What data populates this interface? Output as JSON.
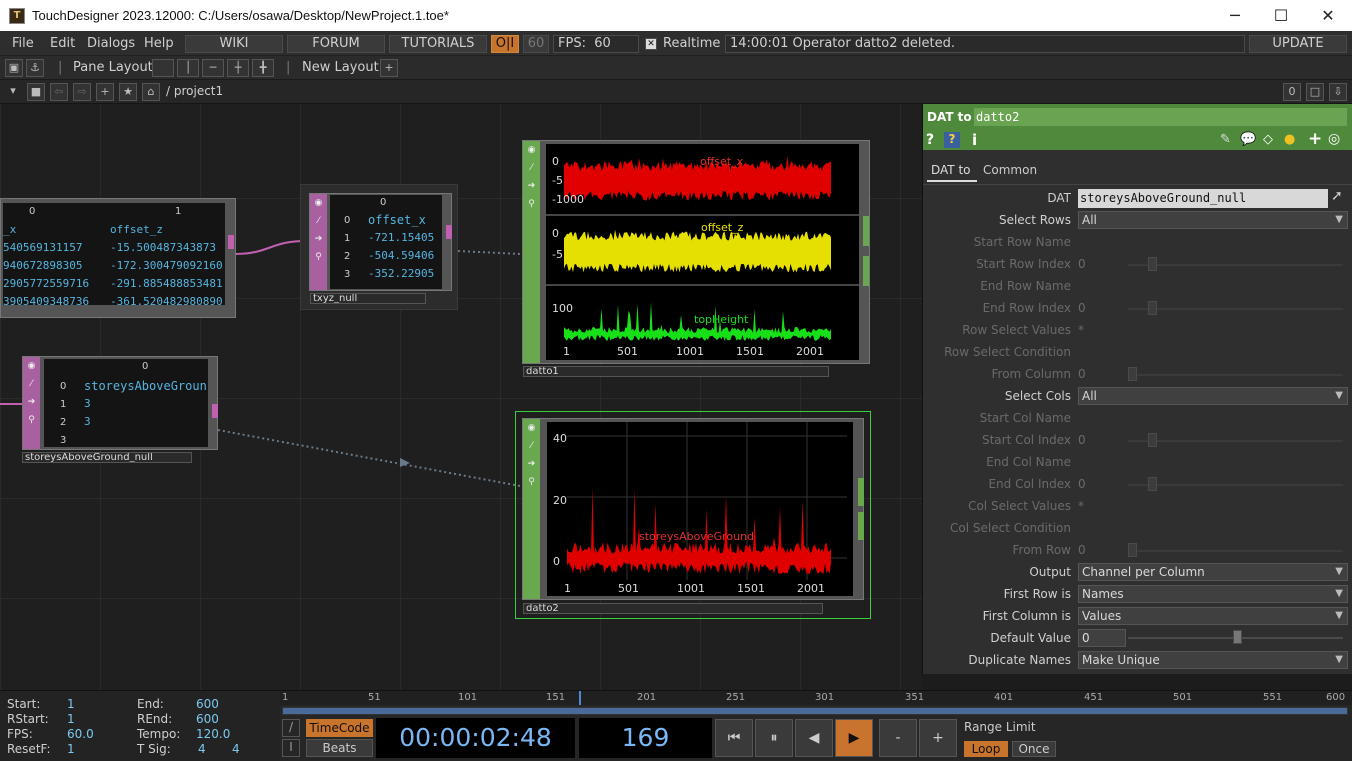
{
  "window": {
    "title": "TouchDesigner 2023.12000: C:/Users/osawa/Desktop/NewProject.1.toe*",
    "minimize": "─",
    "maximize": "☐",
    "close": "✕"
  },
  "menu": {
    "file": "File",
    "edit": "Edit",
    "dialogs": "Dialogs",
    "help": "Help",
    "wiki": "WIKI",
    "forum": "FORUM",
    "tutorials": "TUTORIALS",
    "oi": "O|I",
    "fps_cap": "60",
    "fps_label": "FPS:",
    "fps_value": "60",
    "realtime_check": "✕",
    "realtime": "Realtime",
    "status": "14:00:01 Operator datto2 deleted.",
    "update": "UPDATE"
  },
  "panebar": {
    "pane_layout": "Pane Layout",
    "new_layout": "New Layout",
    "plus": "+"
  },
  "pathbar": {
    "path": "/ project1",
    "zero": "0"
  },
  "nodes": {
    "tablepart": {
      "col0": "0",
      "col1": "1",
      "c0": "_x",
      "c1": "offset_z",
      "rows": [
        [
          "540569131157",
          "-15.500487343873"
        ],
        [
          "940672898305",
          "-172.300479092160"
        ],
        [
          "2905772559716",
          "-291.885488853481"
        ],
        [
          "3905409348736",
          "-361.520482980890"
        ]
      ]
    },
    "txyz": {
      "label": "txyz_null",
      "head": "0",
      "rows": [
        [
          "0",
          "offset_x"
        ],
        [
          "1",
          "-721.15405"
        ],
        [
          "2",
          "-504.59406"
        ],
        [
          "3",
          "-352.22905"
        ]
      ]
    },
    "storeys": {
      "label": "storeysAboveGround_null",
      "head": "0",
      "rows": [
        [
          "0",
          "storeysAboveGroun"
        ],
        [
          "1",
          "3"
        ],
        [
          "2",
          "3"
        ],
        [
          "3",
          ""
        ]
      ]
    },
    "datto1": {
      "label": "datto1",
      "ch1": {
        "name": "offset_x",
        "ticks": [
          "0",
          "-5",
          "-1000"
        ]
      },
      "ch2": {
        "name": "offset_z",
        "ticks": [
          "0",
          "-5"
        ]
      },
      "ch3": {
        "name": "topHeight",
        "ticks": [
          "100"
        ]
      },
      "xticks": [
        "1",
        "501",
        "1001",
        "1501",
        "2001"
      ]
    },
    "datto2": {
      "label": "datto2",
      "channel": "storeysAboveGround",
      "yticks": [
        "40",
        "20",
        "0"
      ],
      "xticks": [
        "1",
        "501",
        "1001",
        "1501",
        "2001"
      ]
    }
  },
  "params": {
    "op_type": "DAT to",
    "op_name": "datto2",
    "tab_dat": "DAT to",
    "tab_common": "Common",
    "dat_label": "DAT",
    "dat_value": "storeysAboveGround_null",
    "select_rows": "Select Rows",
    "select_rows_val": "All",
    "start_row_name": "Start Row Name",
    "start_row_index": "Start Row Index",
    "start_row_index_val": "0",
    "end_row_name": "End Row  Name",
    "end_row_index": "End Row Index",
    "end_row_index_val": "0",
    "row_select_values": "Row Select Values",
    "row_select_values_val": "*",
    "row_select_condition": "Row Select Condition",
    "from_column": "From Column",
    "from_column_val": "0",
    "select_cols": "Select Cols",
    "select_cols_val": "All",
    "start_col_name": "Start Col Name",
    "start_col_index": "Start Col Index",
    "start_col_index_val": "0",
    "end_col_name": "End Col Name",
    "end_col_index": "End Col Index",
    "end_col_index_val": "0",
    "col_select_values": "Col Select Values",
    "col_select_values_val": "*",
    "col_select_condition": "Col Select Condition",
    "from_row": "From Row",
    "from_row_val": "0",
    "output": "Output",
    "output_val": "Channel per Column",
    "first_row_is": "First Row is",
    "first_row_is_val": "Names",
    "first_col_is": "First Column is",
    "first_col_is_val": "Values",
    "default_value": "Default Value",
    "default_value_val": "0",
    "duplicate_names": "Duplicate Names",
    "duplicate_names_val": "Make Unique"
  },
  "timeinfo": {
    "start": "Start:",
    "start_v": "1",
    "end": "End:",
    "end_v": "600",
    "rstart": "RStart:",
    "rstart_v": "1",
    "rend": "REnd:",
    "rend_v": "600",
    "fps": "FPS:",
    "fps_v": "60.0",
    "tempo": "Tempo:",
    "tempo_v": "120.0",
    "resetf": "ResetF:",
    "resetf_v": "1",
    "tsig": "T Sig:",
    "tsig_a": "4",
    "tsig_b": "4"
  },
  "timeline": {
    "ticks": [
      "1",
      "51",
      "101",
      "151",
      "201",
      "251",
      "301",
      "351",
      "401",
      "451",
      "501",
      "551",
      "600"
    ],
    "timecode_btn": "TimeCode",
    "beats_btn": "Beats",
    "timecode": "00:00:02:48",
    "frame": "169",
    "range_limit": "Range Limit",
    "loop": "Loop",
    "once": "Once",
    "minus": "-",
    "plus": "+"
  }
}
